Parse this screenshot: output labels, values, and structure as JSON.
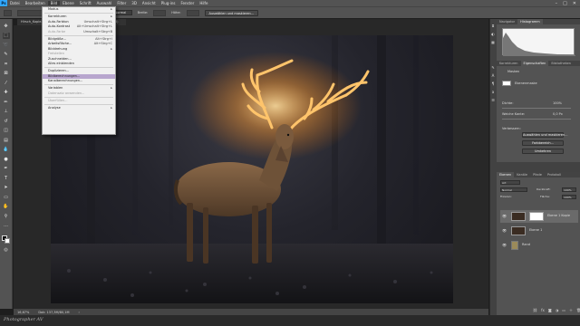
{
  "menubar": {
    "logo": "Ps",
    "items": [
      "Datei",
      "Bearbeiten",
      "Bild",
      "Ebene",
      "Schrift",
      "Auswahl",
      "Filter",
      "3D",
      "Ansicht",
      "Plug-ins",
      "Fenster",
      "Hilfe"
    ],
    "active_index": 2,
    "window_controls": [
      "–",
      "□",
      "✕"
    ]
  },
  "options_bar": {
    "label_mode": "Modus:",
    "mode_value": "Normal",
    "label_width": "Breite:",
    "label_height": "Höhe:",
    "select_button": "Auswählen und maskieren..."
  },
  "document": {
    "tab_title": "Hirsch_Kopie.psd bei 16,7% (Ebene 1 Kopie, Ebenenmaske/8)"
  },
  "dropdown": {
    "items": [
      {
        "label": "Modus",
        "shortcut": "▸",
        "type": "item"
      },
      {
        "type": "sep"
      },
      {
        "label": "Korrekturen",
        "shortcut": "▸",
        "type": "item"
      },
      {
        "label": "Auto-Farbton",
        "shortcut": "Umschalt+Strg+L",
        "type": "item"
      },
      {
        "label": "Auto-Kontrast",
        "shortcut": "Alt+Umschalt+Strg+L",
        "type": "item"
      },
      {
        "label": "Auto-Farbe",
        "shortcut": "Umschalt+Strg+B",
        "type": "item",
        "disabled": true
      },
      {
        "type": "sep"
      },
      {
        "label": "Bildgröße...",
        "shortcut": "Alt+Strg+I",
        "type": "item"
      },
      {
        "label": "Arbeitsfläche...",
        "shortcut": "Alt+Strg+C",
        "type": "item"
      },
      {
        "label": "Bilddrehung",
        "shortcut": "▸",
        "type": "item"
      },
      {
        "label": "Freistellen",
        "shortcut": "",
        "type": "item",
        "disabled": true
      },
      {
        "label": "Zuschneiden...",
        "shortcut": "",
        "type": "item"
      },
      {
        "label": "Alles einblenden",
        "shortcut": "",
        "type": "item"
      },
      {
        "type": "sep"
      },
      {
        "label": "Duplizieren...",
        "shortcut": "",
        "type": "item"
      },
      {
        "label": "Bildberechnungen...",
        "shortcut": "",
        "type": "item",
        "highlight": true
      },
      {
        "label": "Kanalberechnungen...",
        "shortcut": "",
        "type": "item"
      },
      {
        "type": "sep"
      },
      {
        "label": "Variablen",
        "shortcut": "▸",
        "type": "item"
      },
      {
        "label": "Datensatz anwenden...",
        "shortcut": "",
        "type": "item",
        "disabled": true
      },
      {
        "type": "sep"
      },
      {
        "label": "Überfüllen...",
        "shortcut": "",
        "type": "item",
        "disabled": true
      },
      {
        "type": "sep"
      },
      {
        "label": "Analyse",
        "shortcut": "▸",
        "type": "item"
      }
    ]
  },
  "status_bar": {
    "zoom": "16,67%",
    "doc_info": "Dok: 137,3M/80,1M",
    "arrow": "›"
  },
  "watermark": "Photographer AV",
  "histogram_panel": {
    "tabs": [
      "Navigator",
      "Histogramm"
    ],
    "active": 1
  },
  "properties_panel": {
    "tabs": [
      "Korrekturen",
      "Eigenschaften",
      "Bibliotheken"
    ],
    "active": 1,
    "section": "Masken",
    "mask_label": "Ebenenmaske",
    "density_label": "Dichte:",
    "density_value": "100%",
    "feather_label": "Weiche Kante:",
    "feather_value": "0,0 Px",
    "refine_label": "Verbessern:",
    "btn_select_mask": "Auswählen und maskieren...",
    "btn_color_range": "Farbbereich...",
    "btn_invert": "Umkehren"
  },
  "layers_panel": {
    "tabs": [
      "Ebenen",
      "Kanäle",
      "Pfade",
      "Protokoll"
    ],
    "active": 0,
    "filter_label": "Art",
    "blend_mode": "Normal",
    "opacity_label": "Deckkraft:",
    "opacity_value": "100%",
    "lock_label": "Fixieren:",
    "fill_label": "Fläche:",
    "fill_value": "100%",
    "layers": [
      {
        "name": "Ebene 1 Kopie",
        "selected": true
      },
      {
        "name": "Ebene 1",
        "selected": false
      },
      {
        "name": "Rand",
        "selected": false
      }
    ]
  },
  "colors": {
    "ps_blue": "#31a8ff",
    "menu_highlight": "#b8a6ce",
    "panel_bg": "#535353",
    "antler_glow": "#ffb347"
  }
}
